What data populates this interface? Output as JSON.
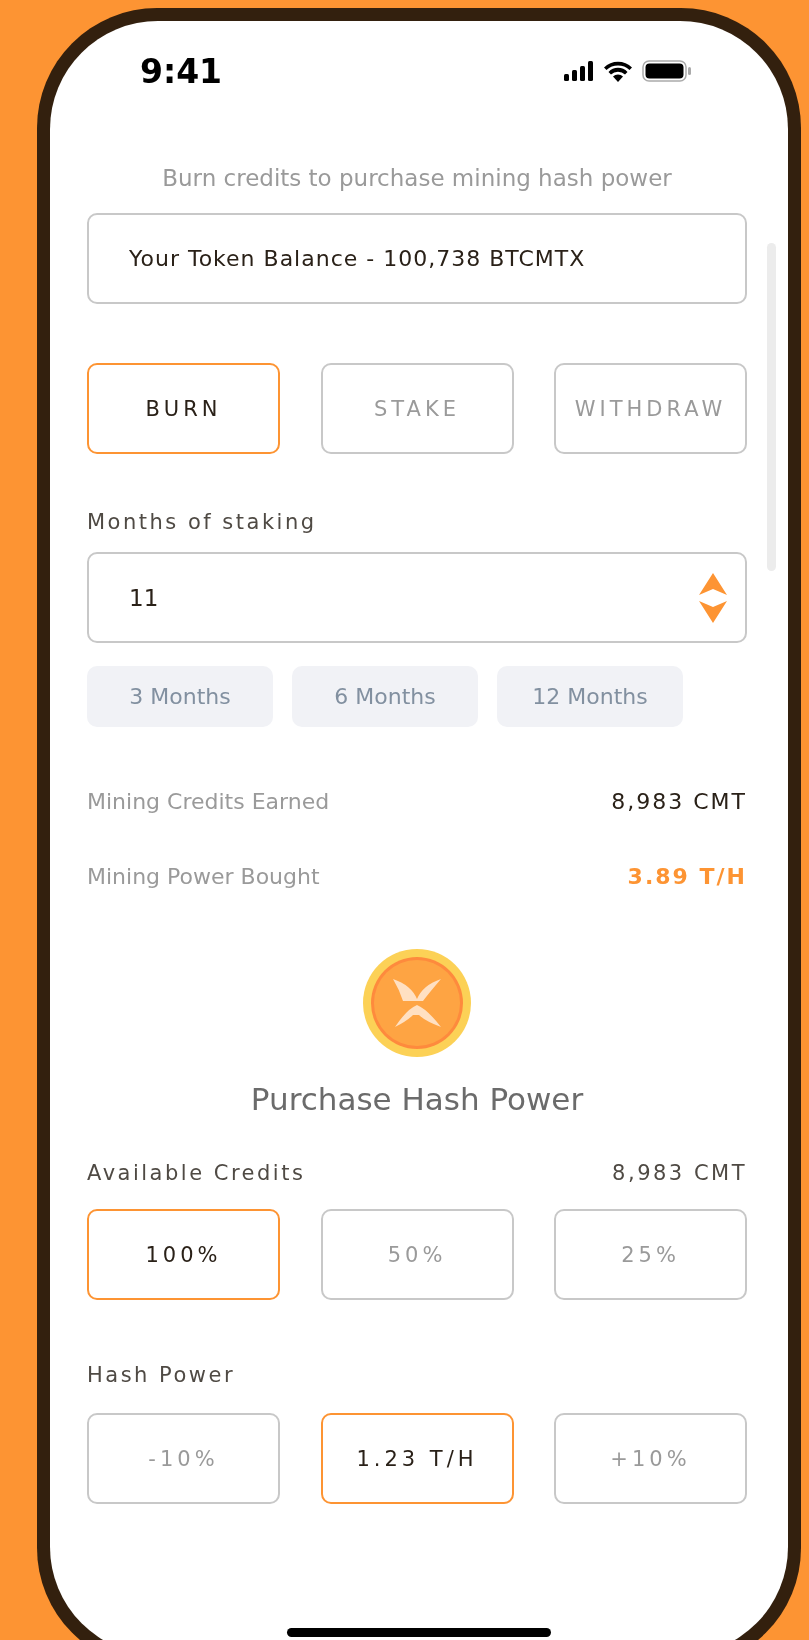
{
  "status_bar": {
    "time": "9:41"
  },
  "subtitle": "Burn credits to purchase mining hash power",
  "balance": "Your Token Balance - 100,738 BTCMTX",
  "modes": [
    {
      "label": "BURN",
      "selected": true
    },
    {
      "label": "STAKE",
      "selected": false
    },
    {
      "label": "WITHDRAW",
      "selected": false
    }
  ],
  "months": {
    "label": "Months of staking",
    "value": "11"
  },
  "presets": [
    "3 Months",
    "6 Months",
    "12 Months"
  ],
  "stats": [
    {
      "label": "Mining Credits Earned",
      "value": "8,983 CMT",
      "highlight": false
    },
    {
      "label": "Mining Power Bought",
      "value": "3.89 T/H",
      "highlight": true
    }
  ],
  "purchase": {
    "title": "Purchase Hash Power",
    "credits_label": "Available Credits",
    "credits_value": "8,983 CMT",
    "credit_options": [
      {
        "label": "100%",
        "selected": true
      },
      {
        "label": "50%",
        "selected": false
      },
      {
        "label": "25%",
        "selected": false
      }
    ],
    "hash_label": "Hash Power",
    "hash_options": [
      {
        "label": "-10%",
        "selected": false
      },
      {
        "label": "1.23 T/H",
        "selected": true
      },
      {
        "label": "+10%",
        "selected": false
      }
    ]
  }
}
